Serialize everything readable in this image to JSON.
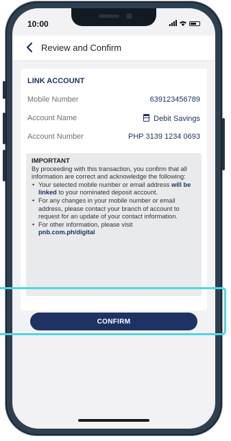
{
  "status_bar": {
    "time": "10:00"
  },
  "app_bar": {
    "title": "Review and Confirm",
    "back_icon": "chevron-left-icon"
  },
  "link_account": {
    "section_title": "LINK ACCOUNT",
    "rows": [
      {
        "label": "Mobile Number",
        "value": "639123456789"
      },
      {
        "label": "Account Name",
        "value": "Debit Savings"
      },
      {
        "label": "Account Number",
        "value": "PHP 3139 1234 0693"
      }
    ]
  },
  "important": {
    "title": "IMPORTANT",
    "intro": "By proceeding with this transaction, you confirm that all information are correct and acknowledge the following:",
    "bullet1_pre": "Your selected mobile number or email address ",
    "bullet1_em": "will be linked",
    "bullet1_post": " to your nominated deposit account.",
    "bullet2": "For any changes in your mobile number or email address, please contact your branch of account to request for an update of your contact information.",
    "bullet3": "For other information, please visit",
    "link": "pnb.com.ph/digital"
  },
  "confirm_button": {
    "label": "CONFIRM"
  },
  "colors": {
    "brand": "#1e3264",
    "highlight": "#4fd6e0"
  }
}
